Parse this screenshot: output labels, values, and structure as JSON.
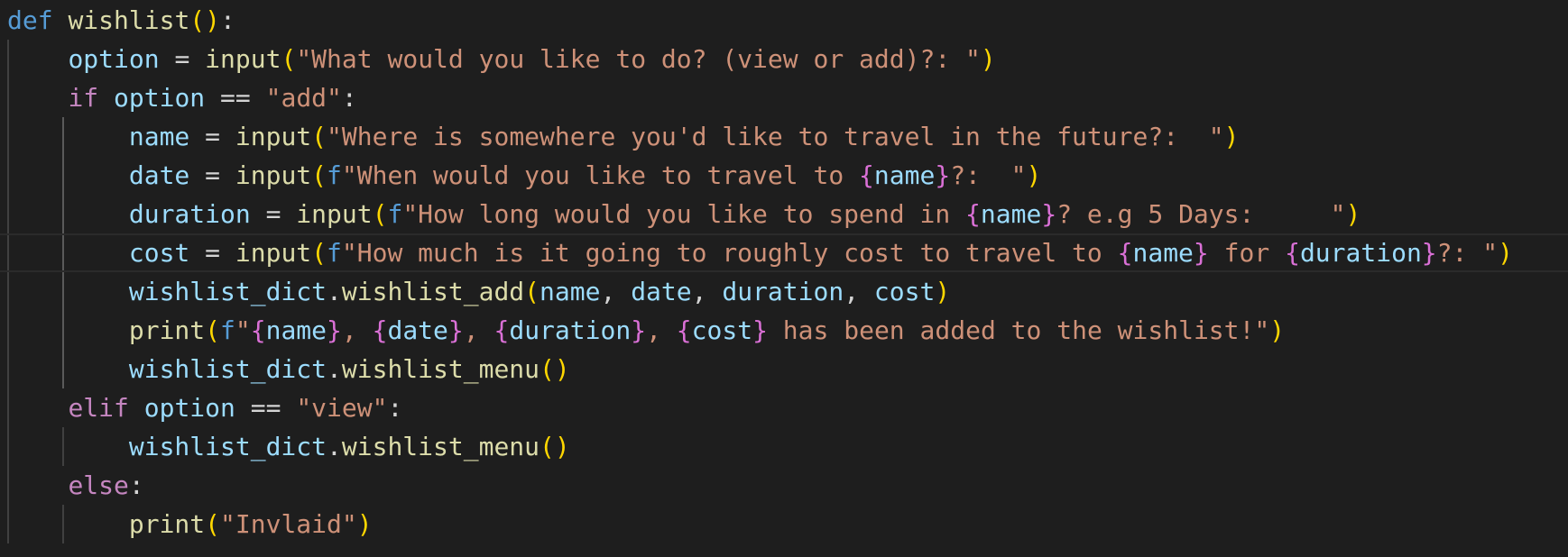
{
  "editor": {
    "language": "python",
    "theme_colors": {
      "background": "#1e1e1e",
      "keyword": "#569cd6",
      "control": "#c586c0",
      "function": "#dcdcaa",
      "variable": "#9cdcfe",
      "string": "#ce9178",
      "bracket_level1": "#ffd700",
      "bracket_level2": "#da70d6"
    },
    "lines": [
      {
        "indent": 0,
        "tokens": [
          {
            "t": "def",
            "k": "kw"
          },
          {
            "t": " ",
            "k": "op"
          },
          {
            "t": "wishlist",
            "k": "fn"
          },
          {
            "t": "()",
            "k": "p1"
          },
          {
            "t": ":",
            "k": "op"
          }
        ]
      },
      {
        "indent": 1,
        "tokens": [
          {
            "t": "option",
            "k": "var"
          },
          {
            "t": " = ",
            "k": "op"
          },
          {
            "t": "input",
            "k": "fn"
          },
          {
            "t": "(",
            "k": "p1"
          },
          {
            "t": "\"What would you like to do? (view or add)?: \"",
            "k": "str"
          },
          {
            "t": ")",
            "k": "p1"
          }
        ]
      },
      {
        "indent": 1,
        "tokens": [
          {
            "t": "if",
            "k": "ctl"
          },
          {
            "t": " ",
            "k": "op"
          },
          {
            "t": "option",
            "k": "var"
          },
          {
            "t": " == ",
            "k": "op"
          },
          {
            "t": "\"add\"",
            "k": "str"
          },
          {
            "t": ":",
            "k": "op"
          }
        ]
      },
      {
        "indent": 2,
        "tokens": [
          {
            "t": "name",
            "k": "var"
          },
          {
            "t": " = ",
            "k": "op"
          },
          {
            "t": "input",
            "k": "fn"
          },
          {
            "t": "(",
            "k": "p1"
          },
          {
            "t": "\"Where is somewhere you'd like to travel in the future?:  \"",
            "k": "str"
          },
          {
            "t": ")",
            "k": "p1"
          }
        ]
      },
      {
        "indent": 2,
        "tokens": [
          {
            "t": "date",
            "k": "var"
          },
          {
            "t": " = ",
            "k": "op"
          },
          {
            "t": "input",
            "k": "fn"
          },
          {
            "t": "(",
            "k": "p1"
          },
          {
            "t": "f",
            "k": "fpre"
          },
          {
            "t": "\"When would you like to travel to ",
            "k": "str"
          },
          {
            "t": "{",
            "k": "brace"
          },
          {
            "t": "name",
            "k": "var"
          },
          {
            "t": "}",
            "k": "brace"
          },
          {
            "t": "?:  \"",
            "k": "str"
          },
          {
            "t": ")",
            "k": "p1"
          }
        ]
      },
      {
        "indent": 2,
        "tokens": [
          {
            "t": "duration",
            "k": "var"
          },
          {
            "t": " = ",
            "k": "op"
          },
          {
            "t": "input",
            "k": "fn"
          },
          {
            "t": "(",
            "k": "p1"
          },
          {
            "t": "f",
            "k": "fpre"
          },
          {
            "t": "\"How long would you like to spend in ",
            "k": "str"
          },
          {
            "t": "{",
            "k": "brace"
          },
          {
            "t": "name",
            "k": "var"
          },
          {
            "t": "}",
            "k": "brace"
          },
          {
            "t": "? e.g 5 Days:     \"",
            "k": "str"
          },
          {
            "t": ")",
            "k": "p1"
          }
        ]
      },
      {
        "indent": 2,
        "current": true,
        "tokens": [
          {
            "t": "cost",
            "k": "var"
          },
          {
            "t": " = ",
            "k": "op"
          },
          {
            "t": "input",
            "k": "fn"
          },
          {
            "t": "(",
            "k": "p1"
          },
          {
            "t": "f",
            "k": "fpre"
          },
          {
            "t": "\"How much is it going to roughly cost to travel to ",
            "k": "str"
          },
          {
            "t": "{",
            "k": "brace"
          },
          {
            "t": "name",
            "k": "var"
          },
          {
            "t": "}",
            "k": "brace"
          },
          {
            "t": " for ",
            "k": "str"
          },
          {
            "t": "{",
            "k": "brace"
          },
          {
            "t": "duration",
            "k": "var"
          },
          {
            "t": "}",
            "k": "brace"
          },
          {
            "t": "?: \"",
            "k": "str"
          },
          {
            "t": ")",
            "k": "p1"
          }
        ]
      },
      {
        "indent": 2,
        "tokens": [
          {
            "t": "wishlist_dict",
            "k": "var"
          },
          {
            "t": ".",
            "k": "op"
          },
          {
            "t": "wishlist_add",
            "k": "fn"
          },
          {
            "t": "(",
            "k": "p1"
          },
          {
            "t": "name",
            "k": "var"
          },
          {
            "t": ", ",
            "k": "op"
          },
          {
            "t": "date",
            "k": "var"
          },
          {
            "t": ", ",
            "k": "op"
          },
          {
            "t": "duration",
            "k": "var"
          },
          {
            "t": ", ",
            "k": "op"
          },
          {
            "t": "cost",
            "k": "var"
          },
          {
            "t": ")",
            "k": "p1"
          }
        ]
      },
      {
        "indent": 2,
        "tokens": [
          {
            "t": "print",
            "k": "fn"
          },
          {
            "t": "(",
            "k": "p1"
          },
          {
            "t": "f",
            "k": "fpre"
          },
          {
            "t": "\"",
            "k": "str"
          },
          {
            "t": "{",
            "k": "brace"
          },
          {
            "t": "name",
            "k": "var"
          },
          {
            "t": "}",
            "k": "brace"
          },
          {
            "t": ", ",
            "k": "str"
          },
          {
            "t": "{",
            "k": "brace"
          },
          {
            "t": "date",
            "k": "var"
          },
          {
            "t": "}",
            "k": "brace"
          },
          {
            "t": ", ",
            "k": "str"
          },
          {
            "t": "{",
            "k": "brace"
          },
          {
            "t": "duration",
            "k": "var"
          },
          {
            "t": "}",
            "k": "brace"
          },
          {
            "t": ", ",
            "k": "str"
          },
          {
            "t": "{",
            "k": "brace"
          },
          {
            "t": "cost",
            "k": "var"
          },
          {
            "t": "}",
            "k": "brace"
          },
          {
            "t": " has been added to the wishlist!\"",
            "k": "str"
          },
          {
            "t": ")",
            "k": "p1"
          }
        ]
      },
      {
        "indent": 2,
        "tokens": [
          {
            "t": "wishlist_dict",
            "k": "var"
          },
          {
            "t": ".",
            "k": "op"
          },
          {
            "t": "wishlist_menu",
            "k": "fn"
          },
          {
            "t": "()",
            "k": "p1"
          }
        ]
      },
      {
        "indent": 1,
        "tokens": [
          {
            "t": "elif",
            "k": "ctl"
          },
          {
            "t": " ",
            "k": "op"
          },
          {
            "t": "option",
            "k": "var"
          },
          {
            "t": " == ",
            "k": "op"
          },
          {
            "t": "\"view\"",
            "k": "str"
          },
          {
            "t": ":",
            "k": "op"
          }
        ]
      },
      {
        "indent": 2,
        "tokens": [
          {
            "t": "wishlist_dict",
            "k": "var"
          },
          {
            "t": ".",
            "k": "op"
          },
          {
            "t": "wishlist_menu",
            "k": "fn"
          },
          {
            "t": "()",
            "k": "p1"
          }
        ]
      },
      {
        "indent": 1,
        "tokens": [
          {
            "t": "else",
            "k": "ctl"
          },
          {
            "t": ":",
            "k": "op"
          }
        ]
      },
      {
        "indent": 2,
        "tokens": [
          {
            "t": "print",
            "k": "fn"
          },
          {
            "t": "(",
            "k": "p1"
          },
          {
            "t": "\"Invlaid\"",
            "k": "str"
          },
          {
            "t": ")",
            "k": "p1"
          }
        ]
      }
    ]
  }
}
